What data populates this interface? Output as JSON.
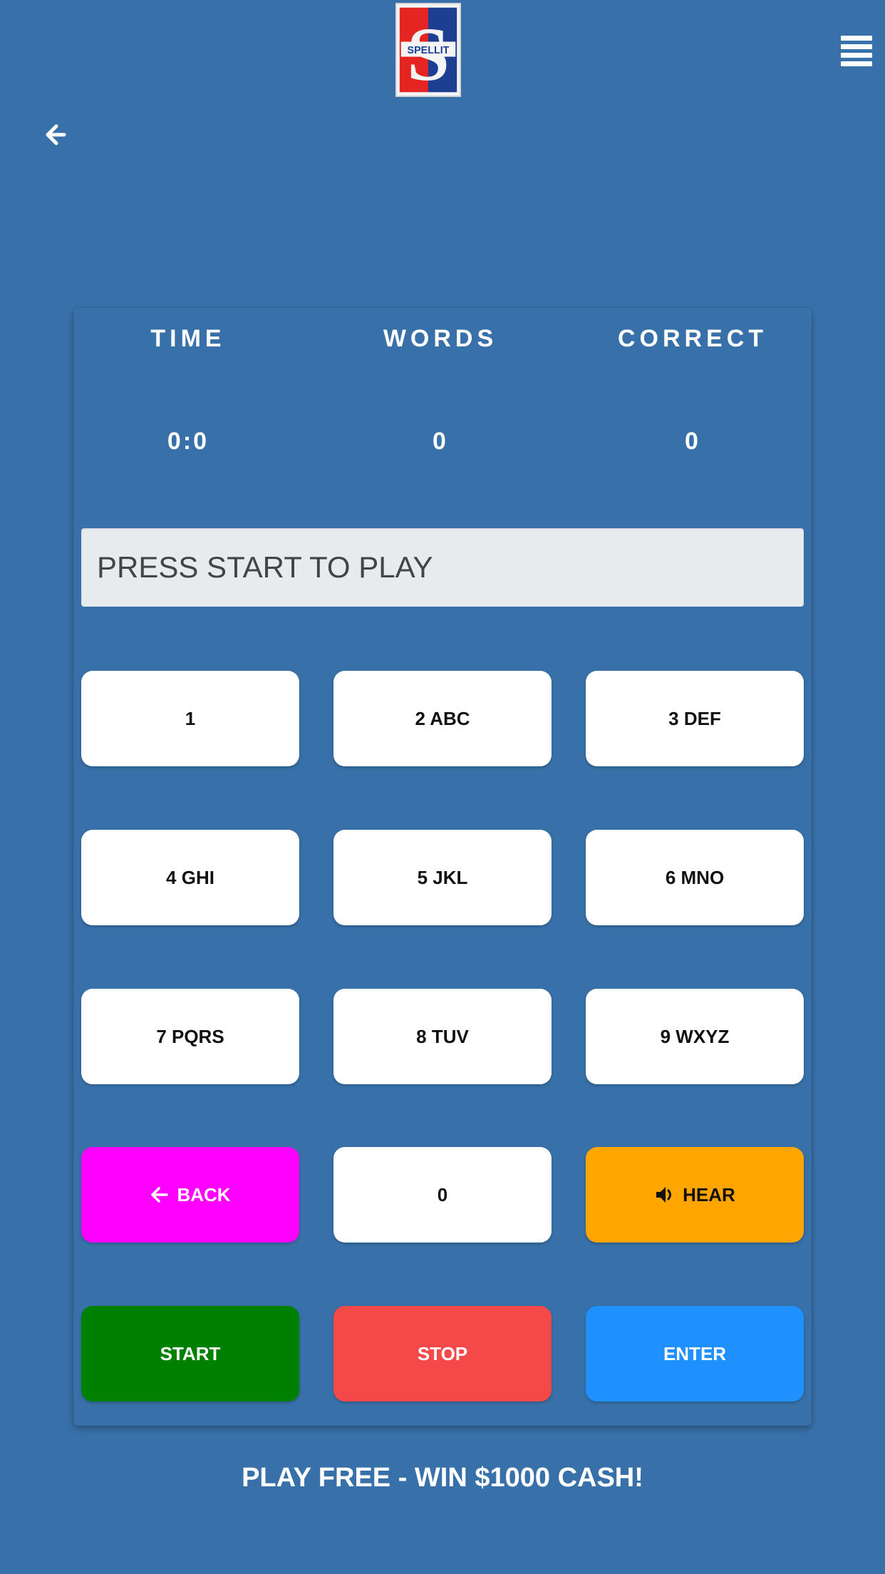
{
  "header": {
    "logo_text": "SPELLIT",
    "menu_icon": "hamburger-menu-icon",
    "back_icon": "arrow-left-icon"
  },
  "stats": {
    "time_label": "TIME",
    "words_label": "WORDS",
    "correct_label": "CORRECT",
    "time_value": "0:0",
    "words_value": "0",
    "correct_value": "0"
  },
  "display": {
    "text": "PRESS START TO PLAY"
  },
  "keypad": {
    "key_1": "1",
    "key_2": "2 ABC",
    "key_3": "3 DEF",
    "key_4": "4 GHI",
    "key_5": "5 JKL",
    "key_6": "6 MNO",
    "key_7": "7 PQRS",
    "key_8": "8 TUV",
    "key_9": "9 WXYZ",
    "key_0": "0",
    "back_label": "BACK",
    "hear_label": "HEAR"
  },
  "controls": {
    "start_label": "START",
    "stop_label": "STOP",
    "enter_label": "ENTER"
  },
  "footer": {
    "promo": "PLAY FREE - WIN $1000 CASH!"
  },
  "colors": {
    "background": "#3871a9",
    "back_button": "#ff00ff",
    "hear_button": "#ffa500",
    "start_button": "#008000",
    "stop_button": "#f54848",
    "enter_button": "#1e90ff",
    "display_bg": "#e8ebee"
  }
}
